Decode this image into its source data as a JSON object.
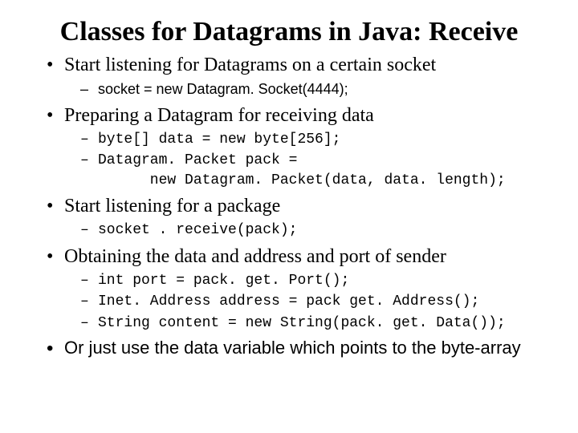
{
  "title": "Classes for Datagrams in Java: Receive",
  "items": [
    {
      "text": "Start listening for Datagrams on a certain socket",
      "style": "serif",
      "sub": [
        {
          "text": "socket = new Datagram. Socket(4444);",
          "style": "sans"
        }
      ]
    },
    {
      "text": "Preparing a Datagram for receiving data",
      "style": "serif",
      "sub": [
        {
          "text": "byte[] data = new byte[256];",
          "style": "mono"
        },
        {
          "text": "Datagram. Packet pack =\n      new Datagram. Packet(data, data. length);",
          "style": "mono"
        }
      ]
    },
    {
      "text": "Start listening for a package",
      "style": "serif",
      "sub": [
        {
          "text": "socket . receive(pack);",
          "style": "mono"
        }
      ]
    },
    {
      "text": "Obtaining the data and address and port of sender",
      "style": "serif",
      "sub": [
        {
          "text": "int port = pack. get. Port();",
          "style": "mono"
        },
        {
          "text": "Inet. Address address = pack get. Address();",
          "style": "mono"
        },
        {
          "text": "String content = new String(pack. get. Data());",
          "style": "mono"
        }
      ]
    },
    {
      "text": "Or just use the data variable which points to the byte-array",
      "style": "sans",
      "sub": []
    }
  ]
}
